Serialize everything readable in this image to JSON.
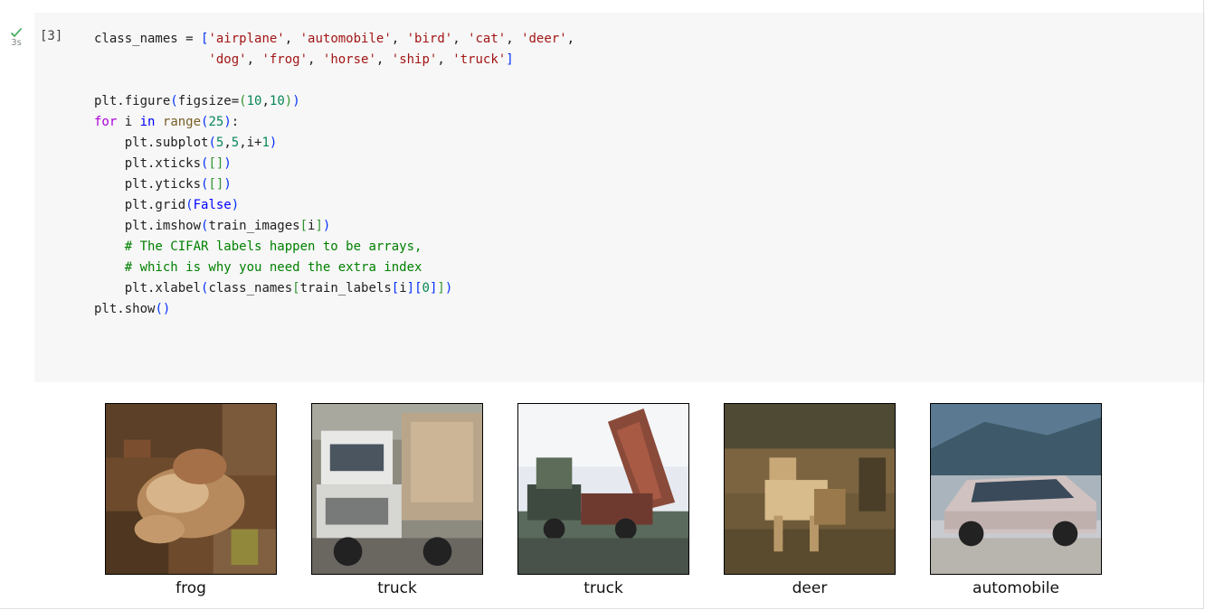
{
  "cell": {
    "execution_count": "[3]",
    "run_time": "3s",
    "code_lines": [
      [
        [
          "t",
          "class_names "
        ],
        [
          "p",
          "= "
        ],
        [
          "br",
          "["
        ],
        [
          "str",
          "'airplane'"
        ],
        [
          "t",
          ", "
        ],
        [
          "str",
          "'automobile'"
        ],
        [
          "t",
          ", "
        ],
        [
          "str",
          "'bird'"
        ],
        [
          "t",
          ", "
        ],
        [
          "str",
          "'cat'"
        ],
        [
          "t",
          ", "
        ],
        [
          "str",
          "'deer'"
        ],
        [
          "t",
          ","
        ]
      ],
      [
        [
          "t",
          "               "
        ],
        [
          "str",
          "'dog'"
        ],
        [
          "t",
          ", "
        ],
        [
          "str",
          "'frog'"
        ],
        [
          "t",
          ", "
        ],
        [
          "str",
          "'horse'"
        ],
        [
          "t",
          ", "
        ],
        [
          "str",
          "'ship'"
        ],
        [
          "t",
          ", "
        ],
        [
          "str",
          "'truck'"
        ],
        [
          "br",
          "]"
        ]
      ],
      [],
      [
        [
          "t",
          "plt.figure"
        ],
        [
          "br",
          "("
        ],
        [
          "t",
          "figsize="
        ],
        [
          "br2",
          "("
        ],
        [
          "num",
          "10"
        ],
        [
          "t",
          ","
        ],
        [
          "num",
          "10"
        ],
        [
          "br2",
          ")"
        ],
        [
          "br",
          ")"
        ]
      ],
      [
        [
          "kw",
          "for"
        ],
        [
          "t",
          " i "
        ],
        [
          "kw2",
          "in"
        ],
        [
          "t",
          " "
        ],
        [
          "fn",
          "range"
        ],
        [
          "br",
          "("
        ],
        [
          "num",
          "25"
        ],
        [
          "br",
          ")"
        ],
        [
          "t",
          ":"
        ]
      ],
      [
        [
          "t",
          "    plt.subplot"
        ],
        [
          "br",
          "("
        ],
        [
          "num",
          "5"
        ],
        [
          "t",
          ","
        ],
        [
          "num",
          "5"
        ],
        [
          "t",
          ",i+"
        ],
        [
          "num",
          "1"
        ],
        [
          "br",
          ")"
        ]
      ],
      [
        [
          "t",
          "    plt.xticks"
        ],
        [
          "br",
          "("
        ],
        [
          "br2",
          "[]"
        ],
        [
          "br",
          ")"
        ]
      ],
      [
        [
          "t",
          "    plt.yticks"
        ],
        [
          "br",
          "("
        ],
        [
          "br2",
          "[]"
        ],
        [
          "br",
          ")"
        ]
      ],
      [
        [
          "t",
          "    plt.grid"
        ],
        [
          "br",
          "("
        ],
        [
          "bool",
          "False"
        ],
        [
          "br",
          ")"
        ]
      ],
      [
        [
          "t",
          "    plt.imshow"
        ],
        [
          "br",
          "("
        ],
        [
          "t",
          "train_images"
        ],
        [
          "br2",
          "["
        ],
        [
          "t",
          "i"
        ],
        [
          "br2",
          "]"
        ],
        [
          "br",
          ")"
        ]
      ],
      [
        [
          "t",
          "    "
        ],
        [
          "com",
          "# The CIFAR labels happen to be arrays,"
        ]
      ],
      [
        [
          "t",
          "    "
        ],
        [
          "com",
          "# which is why you need the extra index"
        ]
      ],
      [
        [
          "t",
          "    plt.xlabel"
        ],
        [
          "br",
          "("
        ],
        [
          "t",
          "class_names"
        ],
        [
          "br2",
          "["
        ],
        [
          "t",
          "train_labels"
        ],
        [
          "br",
          "["
        ],
        [
          "t",
          "i"
        ],
        [
          "br",
          "]"
        ],
        [
          "br",
          "["
        ],
        [
          "num",
          "0"
        ],
        [
          "br",
          "]"
        ],
        [
          "br2",
          "]"
        ],
        [
          "br",
          ")"
        ]
      ],
      [
        [
          "t",
          "plt.show"
        ],
        [
          "br",
          "()"
        ]
      ]
    ]
  },
  "output": {
    "images": [
      {
        "label": "frog",
        "icon": "frog-image"
      },
      {
        "label": "truck",
        "icon": "truck-image"
      },
      {
        "label": "truck",
        "icon": "dump-truck-image"
      },
      {
        "label": "deer",
        "icon": "deer-image"
      },
      {
        "label": "automobile",
        "icon": "car-image"
      }
    ]
  }
}
